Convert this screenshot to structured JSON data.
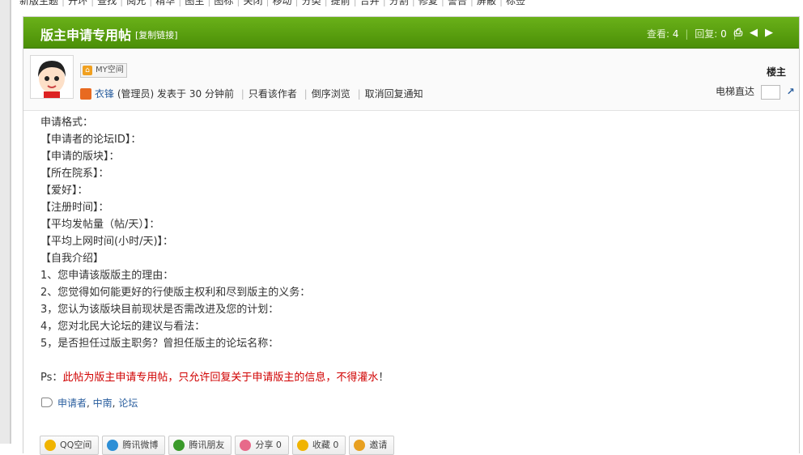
{
  "top_nav": [
    "新版主题",
    "开环",
    "查找",
    "阅兄",
    "精华",
    "图主",
    "图标",
    "关闭",
    "移动",
    "分类",
    "提前",
    "合并",
    "分割",
    "修复",
    "警告",
    "屏蔽",
    "标签"
  ],
  "thread": {
    "title": "版主申请专用帖",
    "copy_link": "[复制链接]",
    "views_label": "查看:",
    "views": "4",
    "replies_label": "回复:",
    "replies": "0"
  },
  "post": {
    "my_space": "MY空间",
    "floor": "楼主",
    "author": "衣锋",
    "role": "(管理员)",
    "posted": "发表于 30 分钟前",
    "only_author": "只看该作者",
    "reverse_browse": "倒序浏览",
    "cancel_notify": "取消回复通知",
    "elevator_label": "电梯直达",
    "lines": [
      "申请格式：",
      "【申请者的论坛ID】：",
      "【申请的版块】：",
      "【所在院系】：",
      "【爱好】：",
      "【注册时间】：",
      "【平均发帖量（帖/天）】：",
      "【平均上网时间(小时/天)】：",
      "【自我介绍】",
      "1、您申请该版版主的理由：",
      "2、您觉得如何能更好的行使版主权利和尽到版主的义务：",
      "3，您认为该版块目前现状是否需改进及您的计划：",
      "4，您对北民大论坛的建议与看法：",
      "5，是否担任过版主职务？曾担任版主的论坛名称："
    ],
    "ps_prefix": "Ps：",
    "ps_red": "此帖为版主申请专用帖，只允许回复关于申请版主的信息，不得灌水",
    "ps_suffix": "！",
    "tags": [
      "申请者",
      "中南",
      "论坛"
    ]
  },
  "share_buttons": [
    {
      "label": "QQ空间",
      "icon": "qzone-icon",
      "color": "#f0b400"
    },
    {
      "label": "腾讯微博",
      "icon": "tencent-weibo-icon",
      "color": "#2d8fd6"
    },
    {
      "label": "腾讯朋友",
      "icon": "pengyou-icon",
      "color": "#3a9a2a"
    },
    {
      "label": "分享 0",
      "icon": "heart-icon",
      "color": "#e76a8a"
    },
    {
      "label": "收藏 0",
      "icon": "star-icon",
      "color": "#f0b400"
    },
    {
      "label": "邀请",
      "icon": "invite-icon",
      "color": "#e8a020"
    }
  ]
}
